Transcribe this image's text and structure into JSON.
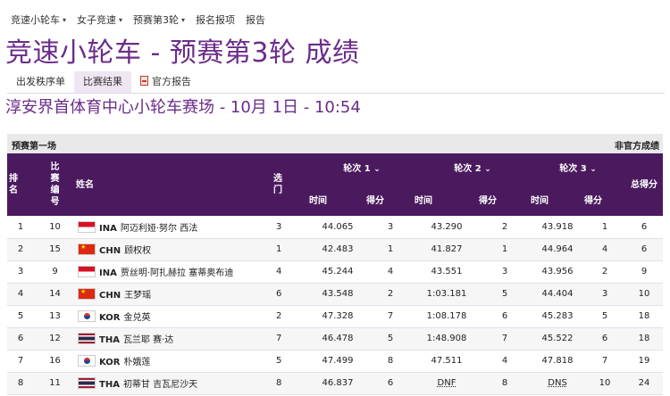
{
  "nav": [
    {
      "label": "竞速小轮车",
      "has_caret": true
    },
    {
      "label": "女子竞速",
      "has_caret": true
    },
    {
      "label": "预赛第3轮",
      "has_caret": true
    },
    {
      "label": "报名报项",
      "has_caret": false
    },
    {
      "label": "报告",
      "has_caret": false
    }
  ],
  "title": "竞速小轮车 - 预赛第3轮 成绩",
  "tabs": [
    {
      "label": "出发秩序单",
      "active": false,
      "icon": ""
    },
    {
      "label": "比赛结果",
      "active": true,
      "icon": ""
    },
    {
      "label": "官方报告",
      "active": false,
      "icon": "pdf-icon"
    }
  ],
  "venue": "淳安界首体育中心小轮车赛场 - 10月 1日 - 10:54",
  "section": {
    "left": "预赛第一场",
    "right": "非官方成绩"
  },
  "headers": {
    "rank": "排名",
    "bib": "比赛编号",
    "name": "姓名",
    "gate": "选门",
    "round1": "轮次 1",
    "round2": "轮次 2",
    "round3": "轮次 3",
    "time": "时间",
    "points": "得分",
    "total": "总得分",
    "sort_icon": "caret-down-icon"
  },
  "rows": [
    {
      "rank": "1",
      "bib": "10",
      "flag": "ina",
      "noc": "INA",
      "name": "阿迈利娅·努尔 西法",
      "gate": "3",
      "t1": "44.065",
      "p1": "3",
      "t2": "43.290",
      "p2": "2",
      "t3": "43.918",
      "p3": "1",
      "total": "6"
    },
    {
      "rank": "2",
      "bib": "15",
      "flag": "chn",
      "noc": "CHN",
      "name": "顾权权",
      "gate": "1",
      "t1": "42.483",
      "p1": "1",
      "t2": "41.827",
      "p2": "1",
      "t3": "44.964",
      "p3": "4",
      "total": "6"
    },
    {
      "rank": "3",
      "bib": "9",
      "flag": "ina",
      "noc": "INA",
      "name": "贾丝明·阿扎赫拉 塞蒂奥布迪",
      "gate": "4",
      "t1": "45.244",
      "p1": "4",
      "t2": "43.551",
      "p2": "3",
      "t3": "43.956",
      "p3": "2",
      "total": "9"
    },
    {
      "rank": "4",
      "bib": "14",
      "flag": "chn",
      "noc": "CHN",
      "name": "王梦瑶",
      "gate": "6",
      "t1": "43.548",
      "p1": "2",
      "t2": "1:03.181",
      "p2": "5",
      "t3": "44.404",
      "p3": "3",
      "total": "10"
    },
    {
      "rank": "5",
      "bib": "13",
      "flag": "kor",
      "noc": "KOR",
      "name": "金兑英",
      "gate": "2",
      "t1": "47.328",
      "p1": "7",
      "t2": "1:08.178",
      "p2": "6",
      "t3": "45.283",
      "p3": "5",
      "total": "18"
    },
    {
      "rank": "6",
      "bib": "12",
      "flag": "tha",
      "noc": "THA",
      "name": "瓦兰耶 赛·达",
      "gate": "7",
      "t1": "46.478",
      "p1": "5",
      "t2": "1:48.908",
      "p2": "7",
      "t3": "45.522",
      "p3": "6",
      "total": "18"
    },
    {
      "rank": "7",
      "bib": "16",
      "flag": "kor",
      "noc": "KOR",
      "name": "朴娥莲",
      "gate": "5",
      "t1": "47.499",
      "p1": "8",
      "t2": "47.511",
      "p2": "4",
      "t3": "47.818",
      "p3": "7",
      "total": "19"
    },
    {
      "rank": "8",
      "bib": "11",
      "flag": "tha",
      "noc": "THA",
      "name": "初蒂甘 吉瓦尼沙天",
      "gate": "8",
      "t1": "46.837",
      "p1": "6",
      "t2": "DNF",
      "p2": "8",
      "t3": "DNS",
      "p3": "10",
      "total": "24"
    }
  ],
  "colors": {
    "accent": "#6b2c8a",
    "header_bg": "#4b1a5e"
  }
}
